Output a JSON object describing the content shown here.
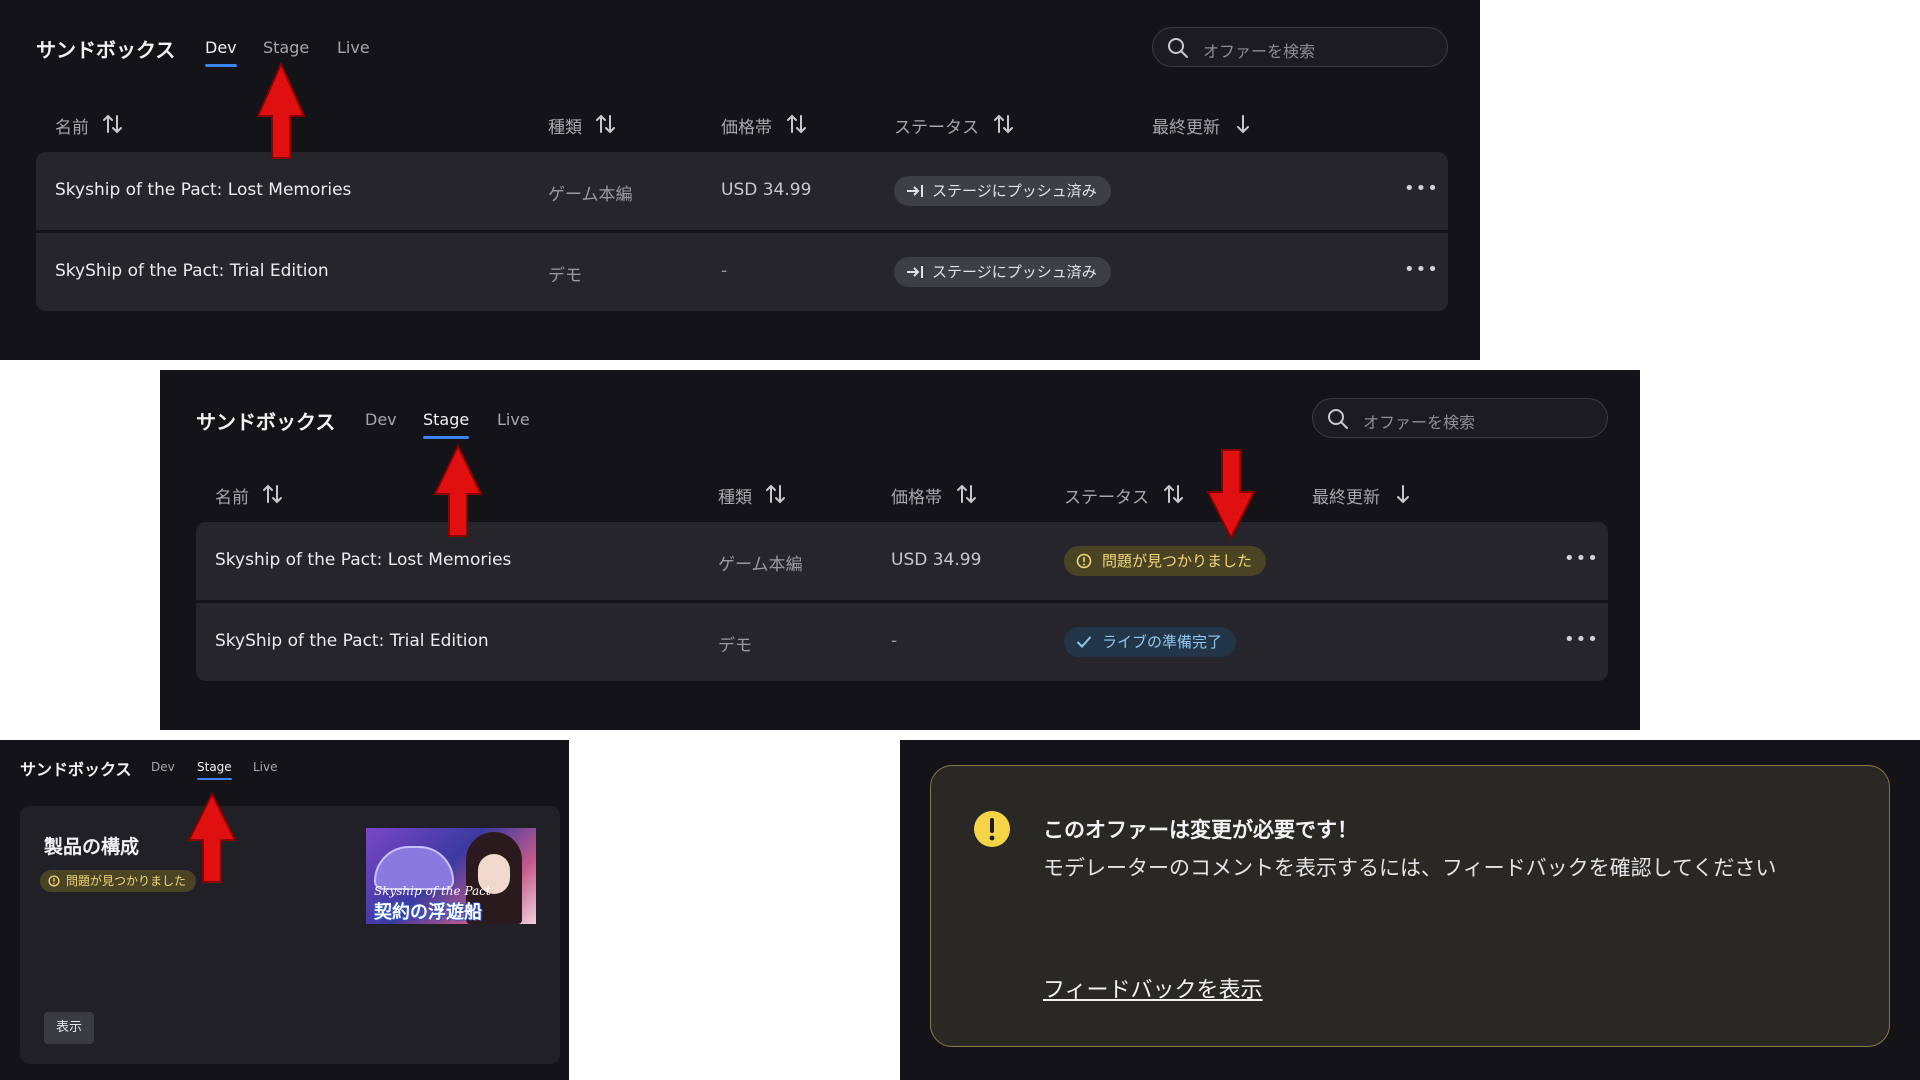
{
  "app": {
    "title": "サンドボックス"
  },
  "tabs": [
    "Dev",
    "Stage",
    "Live"
  ],
  "search": {
    "placeholder": "オファーを検索"
  },
  "columns": {
    "name": "名前",
    "type": "種類",
    "price": "価格帯",
    "status": "ステータス",
    "updated": "最終更新"
  },
  "panel_dev": {
    "active_tab": "Dev",
    "rows": [
      {
        "name": "Skyship of the Pact: Lost Memories",
        "type": "ゲーム本編",
        "price": "USD 34.99",
        "status": "ステージにプッシュ済み"
      },
      {
        "name": "SkyShip of the Pact: Trial Edition",
        "type": "デモ",
        "price": "-",
        "status": "ステージにプッシュ済み"
      }
    ]
  },
  "panel_stage": {
    "active_tab": "Stage",
    "rows": [
      {
        "name": "Skyship of the Pact: Lost Memories",
        "type": "ゲーム本編",
        "price": "USD 34.99",
        "status": "問題が見つかりました"
      },
      {
        "name": "SkyShip of the Pact: Trial Edition",
        "type": "デモ",
        "price": "-",
        "status": "ライブの準備完了"
      }
    ]
  },
  "panel_product": {
    "active_tab": "Stage",
    "card_title": "製品の構成",
    "status": "問題が見つかりました",
    "thumbnail_title_1": "Skyship of the Pact",
    "thumbnail_title_2": "契約の浮遊船",
    "show_button": "表示"
  },
  "alert": {
    "title": "このオファーは変更が必要です！",
    "body": "モデレーターのコメントを表示するには、フィードバックを確認してください",
    "link": "フィードバックを表示"
  },
  "colors": {
    "background": "#131318",
    "row": "#25252b",
    "accent": "#3b82f6",
    "issue": "#f0d878",
    "ready": "#8ec8f2",
    "arrow": "#e01010"
  }
}
